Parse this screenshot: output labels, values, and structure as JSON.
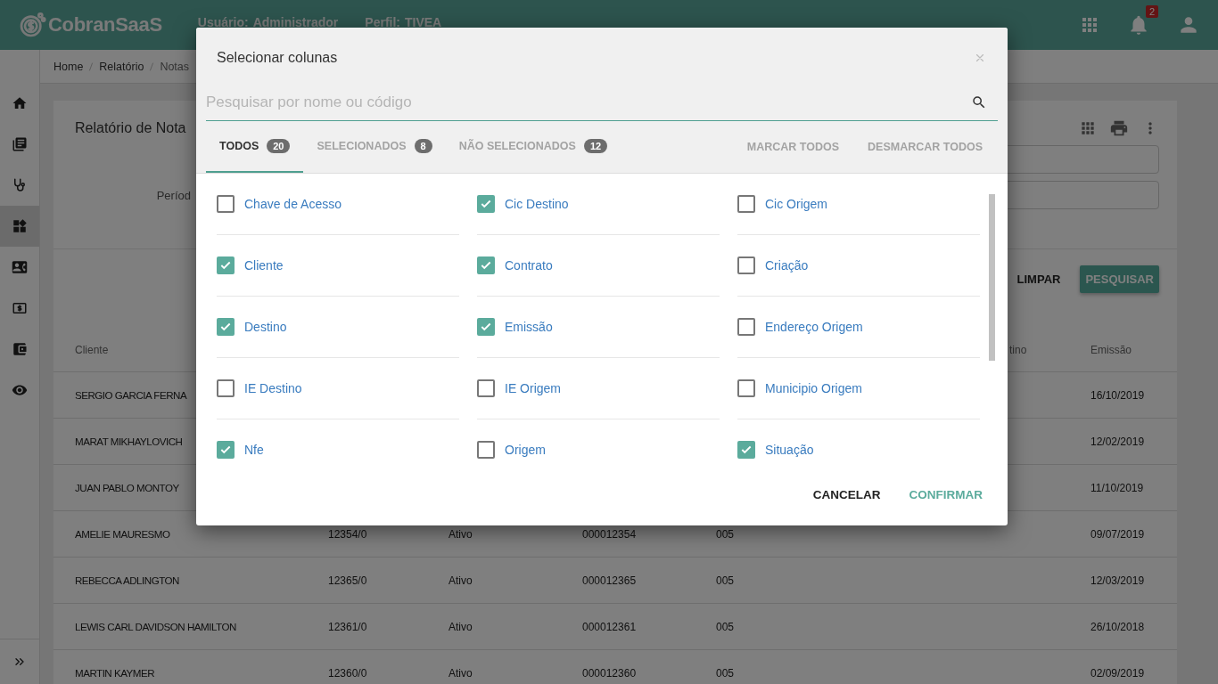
{
  "header": {
    "logo": "CobranSaaS",
    "user_label": "Usuário:",
    "user": "Administrador",
    "profile_label": "Perfil:",
    "profile": "TIVEA",
    "notifications": "2"
  },
  "sidebar": {
    "items": [
      {
        "selected": false
      },
      {
        "selected": false
      },
      {
        "selected": false
      },
      {
        "selected": true
      },
      {
        "selected": false
      },
      {
        "selected": false
      },
      {
        "selected": false
      },
      {
        "selected": false
      }
    ]
  },
  "breadcrumb": [
    "Home",
    "Relatório",
    "Notas"
  ],
  "report": {
    "title": "Relatório de Nota",
    "period_label": "Períod",
    "clear_button": "LIMPAR",
    "search_button": "PESQUISAR"
  },
  "table": {
    "columns": [
      "Cliente",
      "tino",
      "Emissão"
    ],
    "rows": [
      {
        "cliente": "SERGIO GARCIA FERNA",
        "emissao": "16/10/2019"
      },
      {
        "cliente": "MARAT MIKHAYLOVICH",
        "emissao": "12/02/2019"
      },
      {
        "cliente": "JUAN PABLO MONTOY",
        "emissao": "11/10/2019"
      },
      {
        "cliente": "AMELIE MAURESMO",
        "column_2": "12354/0",
        "column_3": "Ativo",
        "column_4": "000012354",
        "column_5": "005",
        "emissao": "09/07/2019"
      },
      {
        "cliente": "REBECCA ADLINGTON",
        "column_2": "12365/0",
        "column_3": "Ativo",
        "column_4": "000012365",
        "column_5": "005",
        "emissao": "12/03/2019"
      },
      {
        "cliente": "LEWIS CARL DAVIDSON HAMILTON",
        "column_2": "12361/0",
        "column_3": "Ativo",
        "column_4": "000012361",
        "column_5": "005",
        "emissao": "26/10/2018"
      },
      {
        "cliente": "MARTIN KAYMER",
        "column_2": "12360/0",
        "column_3": "Ativo",
        "column_4": "000012360",
        "column_5": "005",
        "emissao": "02/09/2019"
      }
    ]
  },
  "modal": {
    "title": "Selecionar colunas",
    "search": {
      "placeholder": "Pesquisar por nome ou código"
    },
    "tabs": [
      {
        "label": "TODOS",
        "count": "20",
        "selected": true
      },
      {
        "label": "SELECIONADOS",
        "count": "8",
        "selected": false
      },
      {
        "label": "NÃO SELECIONADOS",
        "count": "12",
        "selected": false
      }
    ],
    "actions": [
      "MARCAR TODOS",
      "DESMARCAR TODOS"
    ],
    "options": [
      {
        "label": "Chave de Acesso",
        "checked": false
      },
      {
        "label": "Cic Destino",
        "checked": true
      },
      {
        "label": "Cic Origem",
        "checked": false
      },
      {
        "label": "Cliente",
        "checked": true
      },
      {
        "label": "Contrato",
        "checked": true
      },
      {
        "label": "Criação",
        "checked": false
      },
      {
        "label": "Destino",
        "checked": true
      },
      {
        "label": "Emissão",
        "checked": true
      },
      {
        "label": "Endereço Origem",
        "checked": false
      },
      {
        "label": "IE Destino",
        "checked": false
      },
      {
        "label": "IE Origem",
        "checked": false
      },
      {
        "label": "Municipio Origem",
        "checked": false
      },
      {
        "label": "Nfe",
        "checked": true
      },
      {
        "label": "Origem",
        "checked": false
      },
      {
        "label": "Situação",
        "checked": true
      }
    ],
    "buttons": [
      {
        "label": "CANCELAR",
        "kind": "text"
      },
      {
        "label": "CONFIRMAR",
        "kind": "primary"
      }
    ]
  }
}
